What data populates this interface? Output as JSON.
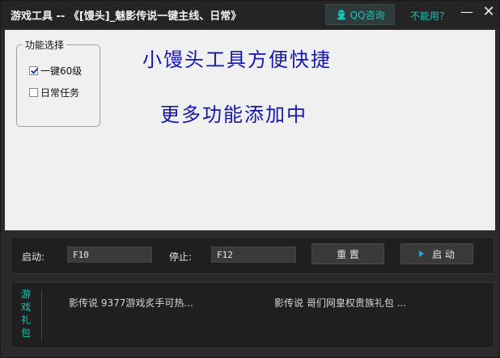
{
  "window": {
    "title": "游戏工具 -- 《[馒头]_魅影传说一键主线、日常》",
    "qq_button": "QQ咨询",
    "cant_use_link": "不能用？",
    "minimize_glyph": "—",
    "close_glyph": "✕"
  },
  "features": {
    "group_title": "功能选择",
    "options": [
      {
        "label": "一键60级",
        "checked": true
      },
      {
        "label": "日常任务",
        "checked": false
      }
    ]
  },
  "slogans": {
    "line1": "小馒头工具方便快捷",
    "line2": "更多功能添加中"
  },
  "controls": {
    "start_label": "启动:",
    "start_hotkey": "F10",
    "stop_label": "停止:",
    "stop_hotkey": "F12",
    "reset_button": "重 置",
    "start_button": "启 动"
  },
  "gifts": {
    "label": "游戏礼包",
    "items": [
      "影传说 9377游戏炙手可热...",
      "影传说 哥们网皇权贵族礼包 ..."
    ]
  },
  "colors": {
    "accent": "#18c8b9",
    "slogan": "#1515b0"
  }
}
